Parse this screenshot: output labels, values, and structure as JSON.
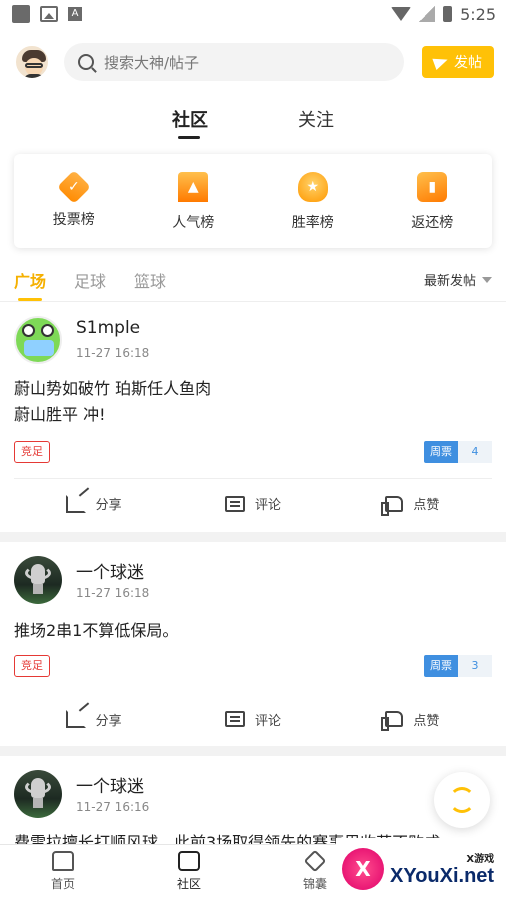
{
  "status_bar": {
    "time": "5:25",
    "a_icon": "A"
  },
  "topbar": {
    "search_placeholder": "搜索大神/帖子",
    "post_button": "发帖"
  },
  "main_tabs": [
    "社区",
    "关注"
  ],
  "rank_items": [
    {
      "label": "投票榜",
      "icon": "vote-rank-icon"
    },
    {
      "label": "人气榜",
      "icon": "popularity-rank-icon"
    },
    {
      "label": "胜率榜",
      "icon": "win-rate-rank-icon"
    },
    {
      "label": "返还榜",
      "icon": "return-rank-icon"
    }
  ],
  "sub_tabs": [
    "广场",
    "足球",
    "篮球"
  ],
  "sort_label": "最新发帖",
  "posts": [
    {
      "name": "S1mple",
      "time": "11-27 16:18",
      "lines": [
        "蔚山势如破竹 珀斯任人鱼肉",
        "蔚山胜平 冲!"
      ],
      "tag": "竞足",
      "vote_label": "周票",
      "vote_count": "4"
    },
    {
      "name": "一个球迷",
      "time": "11-27 16:18",
      "lines": [
        "推场2串1不算低保局。"
      ],
      "tag": "竞足",
      "vote_label": "周票",
      "vote_count": "3"
    },
    {
      "name": "一个球迷",
      "time": "11-27 16:16",
      "lines": [
        "费雷拉擅长打顺风球，此前3场取得领先的赛事里收获不败成"
      ]
    }
  ],
  "actions": {
    "share": "分享",
    "comment": "评论",
    "like": "点赞"
  },
  "bottom_nav": [
    "首页",
    "社区",
    "锦囊"
  ],
  "watermark": {
    "small": "X游戏",
    "big": "XYouXi.net",
    "logo": "X"
  },
  "colors": {
    "accent": "#ffc107",
    "tag_red": "#e53935",
    "vote_blue": "#3f8fe0"
  }
}
